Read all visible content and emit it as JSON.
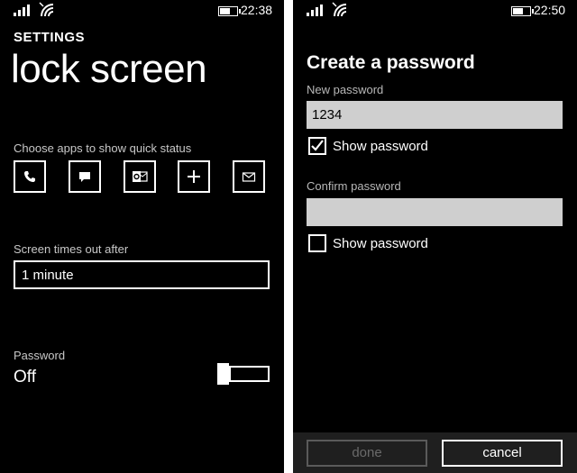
{
  "left_screen": {
    "status_bar": {
      "time": "22:38"
    },
    "header": {
      "app_name": "SETTINGS",
      "title": "lock screen"
    },
    "quick_status": {
      "label": "Choose apps to show quick status",
      "apps": [
        {
          "icon": "phone-icon"
        },
        {
          "icon": "messaging-icon"
        },
        {
          "icon": "outlook-icon"
        },
        {
          "icon": "add-icon"
        },
        {
          "icon": "mail-icon"
        }
      ]
    },
    "timeout": {
      "label": "Screen times out after",
      "value": "1 minute"
    },
    "password": {
      "label": "Password",
      "state": "Off",
      "enabled": false
    }
  },
  "right_screen": {
    "status_bar": {
      "time": "22:50"
    },
    "title": "Create a password",
    "new_password": {
      "label": "New password",
      "value": "1234",
      "show_password_label": "Show password",
      "show_password_checked": true
    },
    "confirm_password": {
      "label": "Confirm password",
      "value": "",
      "show_password_label": "Show password",
      "show_password_checked": false
    },
    "buttons": {
      "done": "done",
      "cancel": "cancel",
      "done_enabled": false
    }
  },
  "colors": {
    "background": "#000000",
    "text": "#ffffff",
    "muted_text": "#c8c8c8",
    "textbox": "#cfcfcf",
    "app_bar": "#1f1f1f"
  }
}
